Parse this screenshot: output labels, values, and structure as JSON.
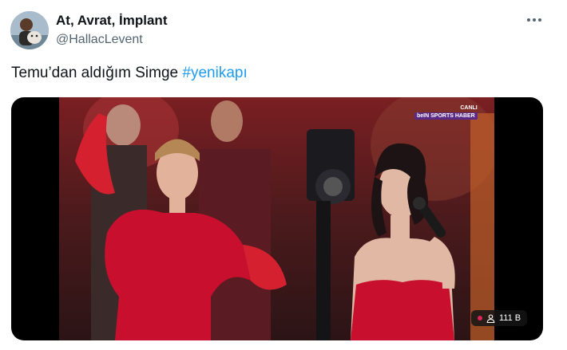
{
  "author": {
    "display_name": "At, Avrat, İmplant",
    "handle": "@HallacLevent"
  },
  "tweet": {
    "text": "Temu’dan aldığım Simge ",
    "hashtag": "#yenikapı"
  },
  "media": {
    "broadcast_live_label": "CANLI",
    "broadcast_brand": "beIN SPORTS HABER",
    "view_count": "111 B"
  },
  "colors": {
    "link": "#1d9bf0",
    "secondary_text": "#536471",
    "dress_red": "#c8102e"
  },
  "icons": [
    "more-icon",
    "user-icon"
  ]
}
